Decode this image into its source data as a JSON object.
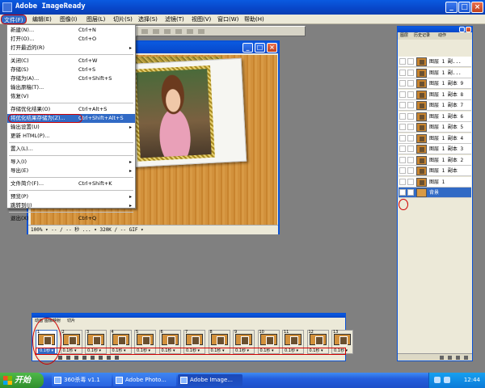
{
  "app": {
    "title": "Adobe ImageReady"
  },
  "menubar": [
    {
      "label": "文件(F)",
      "active": true
    },
    {
      "label": "编辑(E)"
    },
    {
      "label": "图像(I)"
    },
    {
      "label": "图层(L)"
    },
    {
      "label": "切片(S)"
    },
    {
      "label": "选择(S)"
    },
    {
      "label": "滤镜(T)"
    },
    {
      "label": "视图(V)"
    },
    {
      "label": "窗口(W)"
    },
    {
      "label": "帮助(H)"
    }
  ],
  "file_menu": [
    {
      "label": "新建(N)...",
      "shortcut": "Ctrl+N"
    },
    {
      "label": "打开(O)...",
      "shortcut": "Ctrl+O"
    },
    {
      "label": "打开最近的(R)",
      "submenu": true
    },
    {
      "separator": true
    },
    {
      "label": "关闭(C)",
      "shortcut": "Ctrl+W"
    },
    {
      "label": "存储(S)",
      "shortcut": "Ctrl+S"
    },
    {
      "label": "存储为(A)...",
      "shortcut": "Ctrl+Shift+S"
    },
    {
      "label": "输出原稿(T)..."
    },
    {
      "label": "恢复(V)"
    },
    {
      "separator": true
    },
    {
      "label": "存储优化结果(O)",
      "shortcut": "Ctrl+Alt+S"
    },
    {
      "label": "将优化结果存储为(Z)...",
      "shortcut": "Ctrl+Shift+Alt+S",
      "highlighted": true
    },
    {
      "label": "输出设置(U)",
      "submenu": true
    },
    {
      "label": "更新 HTML(P)..."
    },
    {
      "separator": true
    },
    {
      "label": "置入(L)..."
    },
    {
      "separator": true
    },
    {
      "label": "导入(I)",
      "submenu": true
    },
    {
      "label": "导出(E)",
      "submenu": true
    },
    {
      "separator": true
    },
    {
      "label": "文件简介(F)...",
      "shortcut": "Ctrl+Shift+K"
    },
    {
      "separator": true
    },
    {
      "label": "预览(P)",
      "submenu": true
    },
    {
      "label": "跳转到(J)",
      "submenu": true
    },
    {
      "separator": true
    },
    {
      "label": "退出(X)",
      "shortcut": "Ctrl+Q"
    }
  ],
  "document": {
    "status": "100% ▾ -- / -- 秒 ... ▾ 320K / -- GIF ▾"
  },
  "layers_panel": {
    "tabs": [
      "图层",
      "历史记录",
      "动作"
    ],
    "layers": [
      {
        "name": "图层 1 副..."
      },
      {
        "name": "图层 1 副..."
      },
      {
        "name": "图层 1 副本 9"
      },
      {
        "name": "图层 1 副本 8"
      },
      {
        "name": "图层 1 副本 7"
      },
      {
        "name": "图层 1 副本 6"
      },
      {
        "name": "图层 1 副本 5"
      },
      {
        "name": "图层 1 副本 4"
      },
      {
        "name": "图层 1 副本 3"
      },
      {
        "name": "图层 1 副本 2"
      },
      {
        "name": "图层 1 副本"
      },
      {
        "name": "图层 1"
      },
      {
        "name": "背景",
        "selected": true,
        "visible": true
      }
    ]
  },
  "animation_panel": {
    "tabs": [
      "动画",
      "图像映射",
      "切片"
    ],
    "frames": [
      {
        "num": "1",
        "delay": "0.1秒 ▾"
      },
      {
        "num": "2",
        "delay": "0.1秒 ▾"
      },
      {
        "num": "3",
        "delay": "0.1秒 ▾"
      },
      {
        "num": "4",
        "delay": "0.1秒 ▾"
      },
      {
        "num": "5",
        "delay": "0.1秒 ▾"
      },
      {
        "num": "6",
        "delay": "0.1秒 ▾"
      },
      {
        "num": "7",
        "delay": "0.1秒 ▾"
      },
      {
        "num": "8",
        "delay": "0.1秒 ▾"
      },
      {
        "num": "9",
        "delay": "0.1秒 ▾"
      },
      {
        "num": "10",
        "delay": "0.1秒 ▾"
      },
      {
        "num": "11",
        "delay": "0.1秒 ▾"
      },
      {
        "num": "12",
        "delay": "0.1秒 ▾"
      },
      {
        "num": "13",
        "delay": "0.1秒 ▾"
      }
    ]
  },
  "taskbar": {
    "start_label": "开始",
    "buttons": [
      {
        "label": "360杀毒 v1.1"
      },
      {
        "label": "Adobe Photo..."
      },
      {
        "label": "Adobe Image...",
        "active": true
      }
    ],
    "clock": "12:44"
  },
  "colors": {
    "menu_highlight": "#316ac5",
    "annotation_red": "#d00000",
    "canvas_orange": "#d2913c"
  }
}
